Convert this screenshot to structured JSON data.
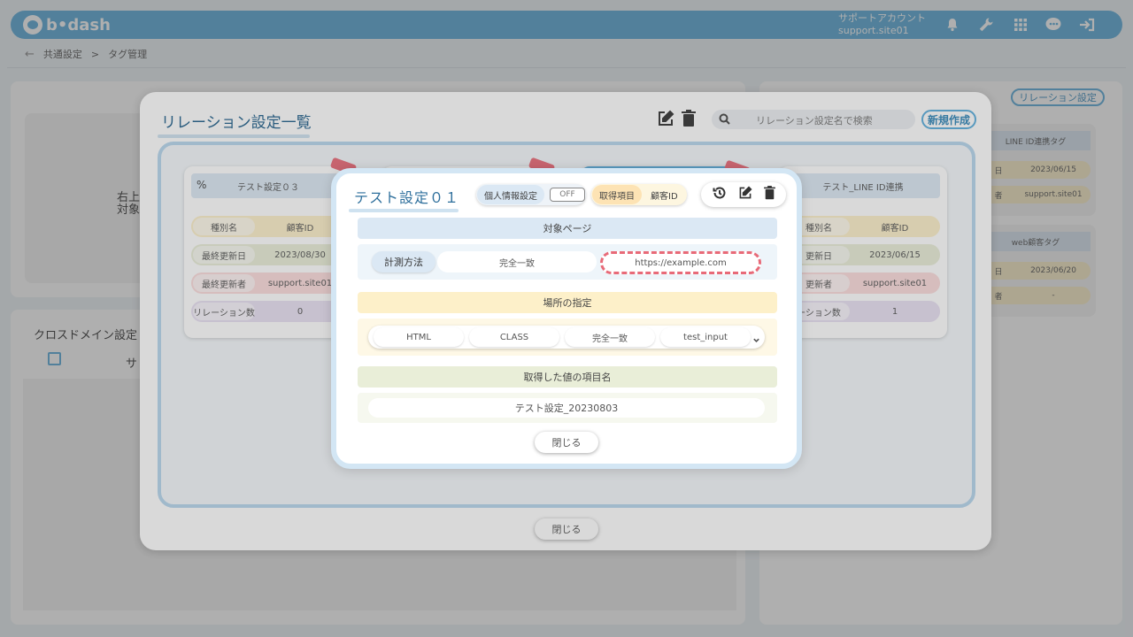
{
  "header": {
    "logo": "b•dash",
    "account_name": "サポートアカウント",
    "account_id": "support.site01"
  },
  "breadcrumb": {
    "back": "←",
    "parent": "共通設定",
    "sep": ">",
    "current": "タグ管理"
  },
  "background": {
    "relation_setting_button": "リレーション設定",
    "left_text_line1": "右上",
    "left_text_line2": "対象",
    "cross_domain_title": "クロスドメイン設定",
    "cross_domain_col": "サ",
    "right_tag1_title": "LINE ID連携タグ",
    "right_tag1_row1_key": "日",
    "right_tag1_row1_val": "2023/06/15",
    "right_tag1_row2_key": "者",
    "right_tag1_row2_val": "support.site01",
    "right_tag2_title": "web顧客タグ",
    "right_tag2_row1_key": "日",
    "right_tag2_row1_val": "2023/06/20",
    "right_tag2_row2_key": "者",
    "right_tag2_row2_val": "-"
  },
  "list_modal": {
    "title": "リレーション設定一覧",
    "search_placeholder": "リレーション設定名で検索",
    "new_button": "新規作成",
    "close_button": "閉じる",
    "card1": {
      "title": "テスト設定０３",
      "rows": [
        {
          "key": "種別名",
          "value": "顧客ID"
        },
        {
          "key": "最終更新日",
          "value": "2023/08/30"
        },
        {
          "key": "最終更新者",
          "value": "support.site01"
        },
        {
          "key": "リレーション数",
          "value": "0"
        }
      ]
    },
    "card4": {
      "title": "テスト_LINE ID連携",
      "rows": [
        {
          "key": "種別名",
          "value": "顧客ID"
        },
        {
          "key": "更新日",
          "value": "2023/06/15"
        },
        {
          "key": "更新者",
          "value": "support.site01"
        },
        {
          "key": "ーション数",
          "value": "1"
        }
      ]
    }
  },
  "detail_modal": {
    "title": "テスト設定０１",
    "personal_info_label": "個人情報設定",
    "personal_info_value": "OFF",
    "acquired_item_label": "取得項目",
    "acquired_item_value": "顧客ID",
    "target_page": {
      "heading": "対象ページ",
      "method_label": "計測方法",
      "method_value": "完全一致",
      "url": "https://example.com"
    },
    "location": {
      "heading": "場所の指定",
      "items": [
        "HTML",
        "CLASS",
        "完全一致",
        "test_input"
      ]
    },
    "item_name": {
      "heading": "取得した値の項目名",
      "value": "テスト設定_20230803"
    },
    "close_button": "閉じる"
  },
  "colors": {
    "header": "#5aaedd",
    "target_page_bg": "#dbe8f4",
    "location_bg": "#fdf0c9",
    "item_name_bg": "#e9eed8",
    "url_highlight": "#e86a78"
  }
}
